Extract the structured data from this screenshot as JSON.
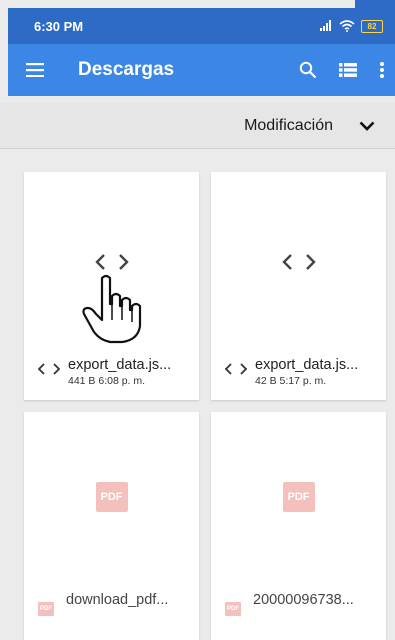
{
  "status_bar": {
    "time": "6:30 PM",
    "signal_icon": "signal-icon",
    "wifi_icon": "wifi-icon",
    "battery_level": "82"
  },
  "app_bar": {
    "title": "Descargas",
    "background": "#3c87e6",
    "menu_icon": "menu-icon",
    "search_icon": "search-icon",
    "view_icon": "list-view-icon",
    "more_icon": "more-vert-icon"
  },
  "sort_bar": {
    "label": "Modificación",
    "chevron_icon": "chevron-down-icon"
  },
  "files": [
    {
      "name": "export_data.js...",
      "detail": "441 B 6:08 p. m.",
      "type": "code-icon"
    },
    {
      "name": "export_data.js...",
      "detail": "42 B 5:17 p. m.",
      "type": "code-icon"
    },
    {
      "name": "download_pdf...",
      "detail": "",
      "type": "pdf-icon",
      "badge": "PDF"
    },
    {
      "name": "20000096738...",
      "detail": "",
      "type": "pdf-icon",
      "badge": "PDF"
    }
  ]
}
